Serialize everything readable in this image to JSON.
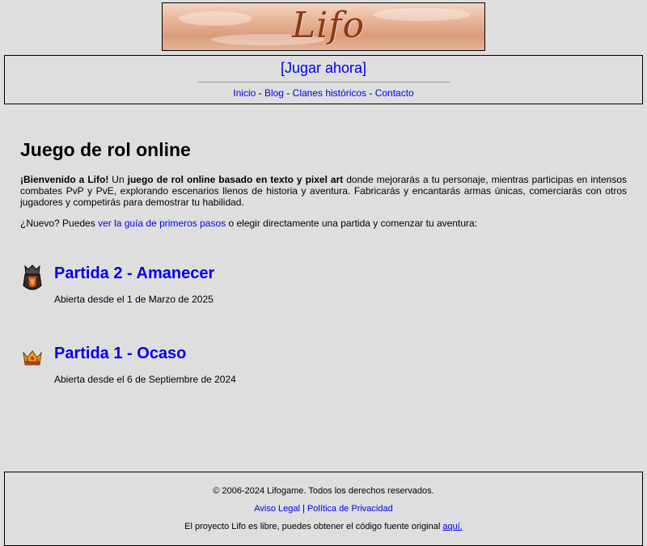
{
  "logo": {
    "text": "Lifo"
  },
  "header": {
    "play_label": "[Jugar ahora]",
    "nav": [
      {
        "label": "Inicio"
      },
      {
        "label": "Blog"
      },
      {
        "label": "Clanes históricos"
      },
      {
        "label": "Contacto"
      }
    ],
    "nav_separator": " - "
  },
  "main": {
    "title": "Juego de rol online",
    "intro": {
      "welcome": "¡Bienvenido a Lifo!",
      "part1": " Un ",
      "bold_phrase": "juego de rol online basado en texto y pixel art",
      "part2": " donde mejorarás a tu personaje, mientras participas en intensos combates PvP y PvE, explorando escenarios llenos de historia y aventura. Fabricarás y encantarás armas únicas, comerciarás con otros jugadores y competirás para demostrar tu habilidad."
    },
    "newbie": {
      "prefix": "¿Nuevo? Puedes ",
      "link": "ver la guía de primeros pasos",
      "suffix": " o elegir directamente una partida y comenzar tu aventura:"
    },
    "games": [
      {
        "title": "Partida 2 - Amanecer",
        "subtitle": "Abierta desde el 1 de Marzo de 2025",
        "icon": "helmet-icon"
      },
      {
        "title": "Partida 1 - Ocaso",
        "subtitle": "Abierta desde el 6 de Septiembre de 2024",
        "icon": "crown-icon"
      }
    ]
  },
  "footer": {
    "copyright": "© 2006-2024 Lifogame. Todos los derechos reservados.",
    "legal": "Aviso Legal",
    "legal_sep": " | ",
    "privacy": "Política de Privacidad",
    "source_prefix": "El proyecto Lifo es libre, puedes obtener el código fuente original ",
    "source_link": "aquí."
  },
  "colors": {
    "background": "#dedede",
    "link": "#0000ee",
    "border": "#000000"
  }
}
